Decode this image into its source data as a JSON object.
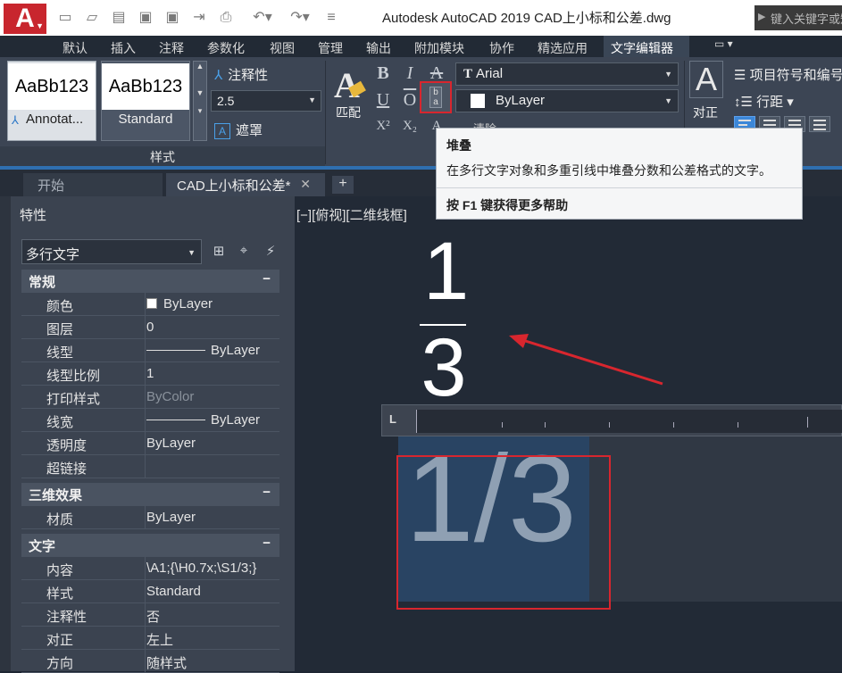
{
  "app": {
    "title": "Autodesk AutoCAD 2019      CAD上小标和公差.dwg",
    "search_placeholder": "键入关键字或短语",
    "logo_letter": "A"
  },
  "ribbon_tabs": [
    "默认",
    "插入",
    "注释",
    "参数化",
    "视图",
    "管理",
    "输出",
    "附加模块",
    "协作",
    "精选应用",
    "文字编辑器"
  ],
  "ribbon": {
    "style_cards": [
      {
        "sample": "AaBb123",
        "name": "Annotat..."
      },
      {
        "sample": "AaBb123",
        "name": "Standard"
      }
    ],
    "annotative_label": "注释性",
    "text_height": "2.5",
    "mask_label": "遮罩",
    "style_panel_label": "样式",
    "match_label": "匹配",
    "bold": "B",
    "italic": "I",
    "strike": "A",
    "underline": "U",
    "overline": "O",
    "superscript": "X²",
    "subscript": "X₂",
    "font_name": "Arial",
    "font_glyph": "T",
    "color_name": "ByLayer",
    "clear_label": "清除",
    "justify_glyph": "A",
    "justify_label": "对正",
    "bullets_label": "项目符号和编号",
    "line_spacing_label": "行距"
  },
  "doc_tabs": {
    "start": "开始",
    "file": "CAD上小标和公差*",
    "close": "✕",
    "add": "+"
  },
  "properties": {
    "title": "特性",
    "object_type": "多行文字",
    "sections": [
      {
        "name": "常规",
        "rows": [
          {
            "key": "颜色",
            "value": "ByLayer",
            "kind": "swatch"
          },
          {
            "key": "图层",
            "value": "0"
          },
          {
            "key": "线型",
            "value": "ByLayer",
            "kind": "line"
          },
          {
            "key": "线型比例",
            "value": "1"
          },
          {
            "key": "打印样式",
            "value": "ByColor",
            "kind": "dim"
          },
          {
            "key": "线宽",
            "value": "ByLayer",
            "kind": "line"
          },
          {
            "key": "透明度",
            "value": "ByLayer"
          },
          {
            "key": "超链接",
            "value": ""
          }
        ]
      },
      {
        "name": "三维效果",
        "rows": [
          {
            "key": "材质",
            "value": "ByLayer"
          }
        ]
      },
      {
        "name": "文字",
        "rows": [
          {
            "key": "内容",
            "value": "\\A1;{\\H0.7x;\\S1/3;}"
          },
          {
            "key": "样式",
            "value": "Standard"
          },
          {
            "key": "注释性",
            "value": "否"
          },
          {
            "key": "对正",
            "value": "左上"
          },
          {
            "key": "方向",
            "value": "随样式"
          }
        ]
      }
    ]
  },
  "viewport": {
    "label": "[−][俯视][二维线框]",
    "stacked_numerator": "1",
    "stacked_denominator": "3",
    "editor_text": "1/3",
    "ruler_corner": "L"
  },
  "tooltip": {
    "title": "堆叠",
    "description": "在多行文字对象和多重引线中堆叠分数和公差格式的文字。",
    "help": "按 F1 键获得更多帮助"
  },
  "colors": {
    "accent_red": "#d8262e",
    "selection_blue": "#294463",
    "ribbon_bg": "#3c4554"
  }
}
